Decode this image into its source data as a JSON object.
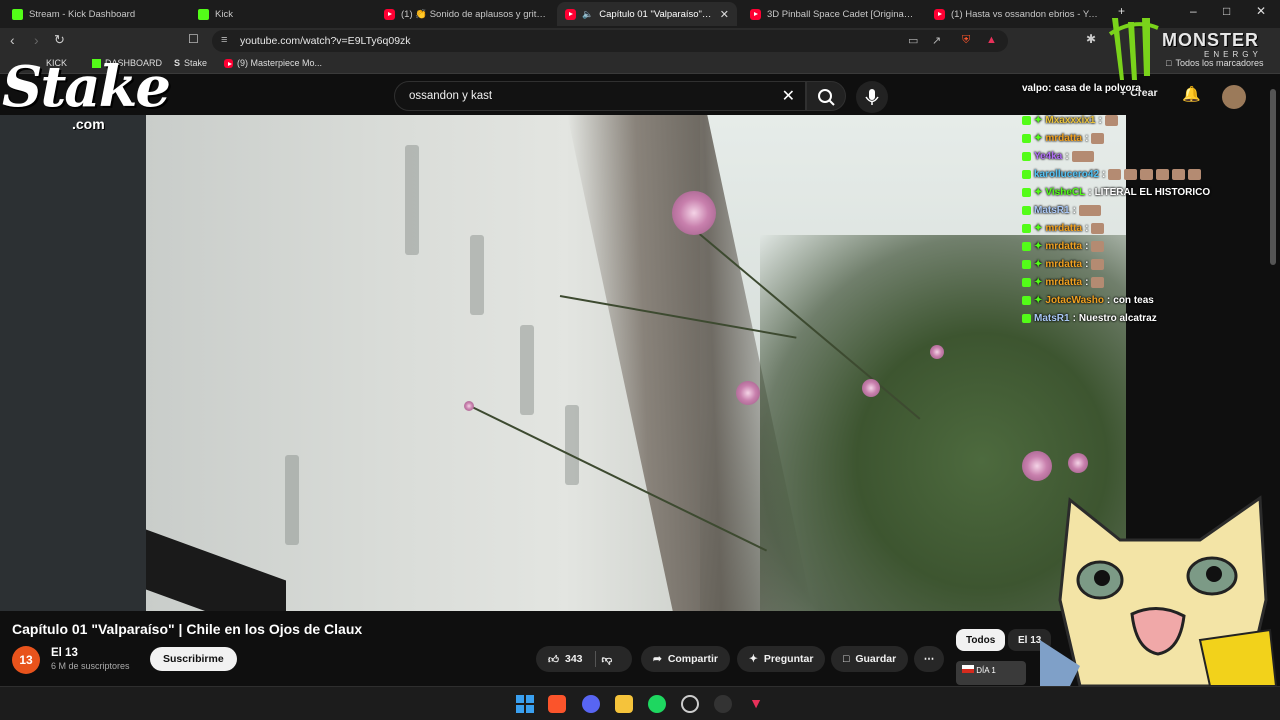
{
  "browser": {
    "tabs": [
      {
        "title": "Stream - Kick Dashboard",
        "favicon": "kick"
      },
      {
        "title": "Kick",
        "favicon": "kick"
      },
      {
        "title": "(1) 👏 Sonido de aplausos y gritos de",
        "favicon": "youtube"
      },
      {
        "title": "Capítulo 01 \"Valparaíso\" | Chile",
        "favicon": "youtube",
        "active": true
      },
      {
        "title": "3D Pinball Space Cadet [Original Sou",
        "favicon": "youtube"
      },
      {
        "title": "(1) Hasta vs ossandon ebrios - YouTu",
        "favicon": "youtube"
      }
    ],
    "url": "youtube.com/watch?v=E9LTy6q09zk",
    "bookmarks": [
      {
        "label": "KICK",
        "icon": "kick"
      },
      {
        "label": "DASHBOARD",
        "icon": "kick"
      },
      {
        "label": "Stake",
        "icon": "stake"
      },
      {
        "label": "(9) Masterpiece Mo...",
        "icon": "youtube"
      }
    ],
    "all_bookmarks_label": "Todos los marcadores"
  },
  "youtube": {
    "search_query": "ossandon y kast",
    "create_label": "Crear",
    "video_title": "Capítulo 01 \"Valparaíso\" | Chile en los Ojos de Claux",
    "channel": {
      "avatar_text": "13",
      "name": "El 13",
      "subscribers": "6 M de suscriptores"
    },
    "subscribe_label": "Suscribirme",
    "likes": "343",
    "share_label": "Compartir",
    "ask_label": "Preguntar",
    "save_label": "Guardar",
    "chips": [
      "Todos",
      "El 13"
    ],
    "up_next_badge": "DÍA 1"
  },
  "chat": [
    {
      "user": "valpo: casa de la polvora",
      "message": "",
      "color": "#ffffff"
    },
    {
      "user": "Mxaxxxix1",
      "message": "",
      "color": "#e8c23a",
      "emotes": 1
    },
    {
      "user": "mrdatta",
      "message": "",
      "color": "#f0a020",
      "emotes": 1
    },
    {
      "user": "Ye4ka",
      "message": "",
      "color": "#b06ef5",
      "emotes": 1
    },
    {
      "user": "karollucero42",
      "message": "",
      "color": "#52c3f5",
      "emotes": 6
    },
    {
      "user": "VisheCL",
      "message": "LITERAL EL HISTORICO",
      "color": "#53fc18"
    },
    {
      "user": "MatsR1",
      "message": "",
      "color": "#a9c7f5",
      "emotes": 1
    },
    {
      "user": "mrdatta",
      "message": "",
      "color": "#f0a020",
      "emotes": 1
    },
    {
      "user": "mrdatta",
      "message": "",
      "color": "#f0a020",
      "emotes": 1
    },
    {
      "user": "mrdatta",
      "message": "",
      "color": "#f0a020",
      "emotes": 1
    },
    {
      "user": "mrdatta",
      "message": "",
      "color": "#f0a020",
      "emotes": 1
    },
    {
      "user": "JotacWasho",
      "message": "con teas",
      "color": "#f0a020"
    },
    {
      "user": "MatsR1",
      "message": "Nuestro alcatraz",
      "color": "#a9c7f5"
    }
  ],
  "overlays": {
    "stake_word": "Stake",
    "stake_com": ".com",
    "monster_word": "MONSTER",
    "monster_sub": "ENERGY"
  },
  "colors": {
    "accent_kick": "#53fc18",
    "youtube_red": "#ff0033",
    "background": "#0f0f0f"
  }
}
